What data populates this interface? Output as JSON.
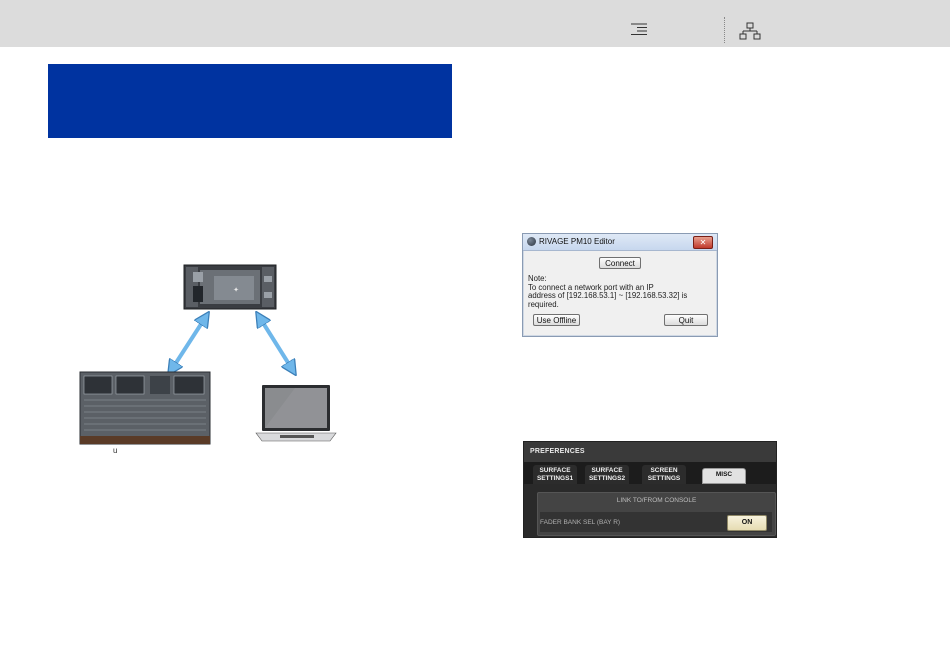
{
  "header": {
    "toc_icon": "list-indent-icon",
    "sitemap_icon": "sitemap-icon"
  },
  "diagram": {
    "caption": "u",
    "arrow_color": "#6fb7ea",
    "devices": [
      "rack-engine-icon",
      "mixing-console-icon",
      "laptop-icon"
    ]
  },
  "editor_dialog": {
    "title": "RIVAGE PM10 Editor",
    "close_label": "✕",
    "connect_label": "Connect",
    "note_lines": [
      "Note:",
      "To connect a network port with an IP",
      "address of [192.168.53.1] ~ [192.168.53.32] is",
      "required."
    ],
    "use_offline_label": "Use Offline",
    "quit_label": "Quit"
  },
  "preferences": {
    "title": "PREFERENCES",
    "tabs": [
      {
        "line1": "SURFACE",
        "line2": "SETTINGS1"
      },
      {
        "line1": "SURFACE",
        "line2": "SETTINGS2"
      },
      {
        "line1": "SCREEN",
        "line2": "SETTINGS"
      },
      {
        "line1": "MISC",
        "line2": ""
      }
    ],
    "section_header": "LINK TO/FROM CONSOLE",
    "row_label": "FADER BANK SEL (BAY R)",
    "on_label": "ON"
  },
  "colors": {
    "banner": "#0033a0",
    "topbar": "#dcdcdc"
  }
}
